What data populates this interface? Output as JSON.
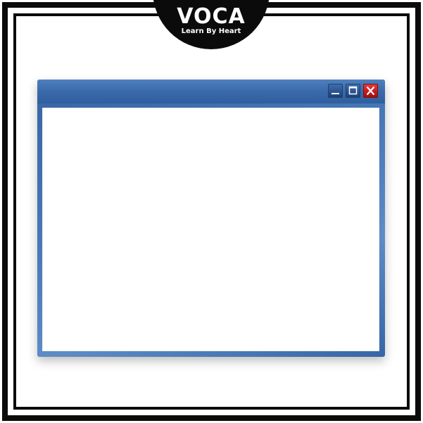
{
  "logo": {
    "brand": "VOCA",
    "tagline": "Learn By Heart"
  },
  "window": {
    "buttons": [
      {
        "name": "minimize",
        "icon": "minimize-icon"
      },
      {
        "name": "maximize",
        "icon": "maximize-icon"
      },
      {
        "name": "close",
        "icon": "close-icon"
      }
    ]
  },
  "colors": {
    "frame": "#0b0b0b",
    "window_blue": "#3a6aaa",
    "close_red": "#c41c1c",
    "client_bg": "#ffffff"
  }
}
